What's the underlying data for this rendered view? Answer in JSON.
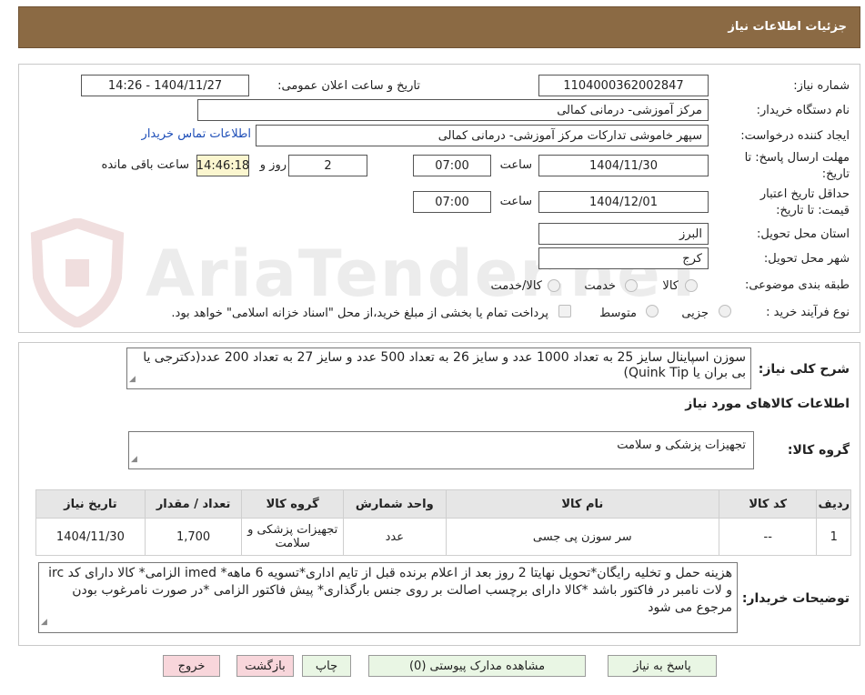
{
  "header": {
    "title": "جزئیات اطلاعات نیاز"
  },
  "watermark": {
    "text": "AriaTender.neT"
  },
  "form": {
    "need_number_label": "شماره نیاز:",
    "need_number": "1104000362002847",
    "announce_label": "تاریخ و ساعت اعلان عمومی:",
    "announce_value": "1404/11/27 - 14:26",
    "buyer_label": "نام دستگاه خریدار:",
    "buyer_value": "مرکز آموزشی- درمانی کمالی",
    "creator_label": "ایجاد کننده درخواست:",
    "creator_value": "سپهر خاموشی تدارکات مرکز آموزشی- درمانی کمالی",
    "contact_link": "اطلاعات تماس خریدار",
    "deadline_label_1": "مهلت ارسال پاسخ: تا",
    "deadline_label_2": "تاریخ:",
    "deadline_date": "1404/11/30",
    "time_label": "ساعت",
    "deadline_time": "07:00",
    "days_value": "2",
    "days_label": "روز و",
    "remaining_time": "14:46:18",
    "remaining_label": "ساعت باقی مانده",
    "validity_label_1": "حداقل تاریخ اعتبار",
    "validity_label_2": "قیمت: تا تاریخ:",
    "validity_date": "1404/12/01",
    "validity_time": "07:00",
    "province_label": "استان محل تحویل:",
    "province_value": "البرز",
    "city_label": "شهر محل تحویل:",
    "city_value": "کرج",
    "category_label": "طبقه بندی موضوعی:",
    "category_options": [
      "کالا",
      "خدمت",
      "کالا/خدمت"
    ],
    "process_label": "نوع فرآیند خرید :",
    "process_options": [
      "جزیی",
      "متوسط"
    ],
    "payment_note": "پرداخت تمام یا بخشی از مبلغ خرید،از محل \"اسناد خزانه اسلامی\" خواهد بود."
  },
  "description": {
    "label": "شرح کلی نیاز:",
    "text": "سوزن اسپاینال سایز 25 به تعداد 1000 عدد و سایز 26 به تعداد 500 عدد و سایز 27 به تعداد 200 عدد(دکترجی یا بی بران یا Quink Tip)"
  },
  "goods_section": {
    "title": "اطلاعات کالاهای مورد نیاز",
    "group_label": "گروه کالا:",
    "group_value": "تجهیزات پزشکی و سلامت"
  },
  "table": {
    "headers": [
      "ردیف",
      "کد کالا",
      "نام کالا",
      "واحد شمارش",
      "گروه کالا",
      "تعداد / مقدار",
      "تاریخ نیاز"
    ],
    "rows": [
      [
        "1",
        "--",
        "سر سوزن پی جسی",
        "عدد",
        "تجهیزات پزشکی و سلامت",
        "1,700",
        "1404/11/30"
      ]
    ]
  },
  "buyer_notes": {
    "label": "توضیحات خریدار:",
    "text": "هزینه حمل و تخلیه رایگان*تحویل نهایتا 2 روز بعد از اعلام برنده قبل از تایم اداری*تسویه 6 ماهه* imed الزامی* کالا دارای کد irc و لات نامبر در فاکتور باشد *کالا دارای برچسب اصالت بر روی جنس بارگذاری* پیش فاکتور الزامی *در صورت نامرغوب بودن مرجوع می شود"
  },
  "buttons": {
    "reply": "پاسخ به نیاز",
    "attachments": "مشاهده مدارک پیوستی (0)",
    "print": "چاپ",
    "back": "بازگشت",
    "exit": "خروج"
  },
  "colors": {
    "header_bg": "#8b6a44",
    "button_green": "#e9f6e4",
    "button_pink": "#f8d6db",
    "remaining_bg": "#fbf6cf",
    "link": "#1f4fb8"
  }
}
